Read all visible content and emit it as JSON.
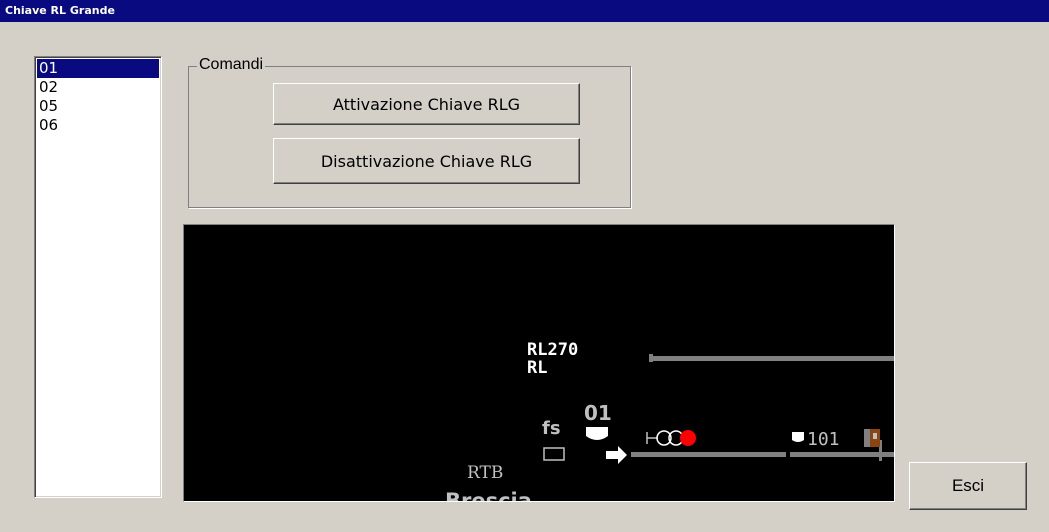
{
  "window": {
    "title": "Chiave RL Grande"
  },
  "list": {
    "items": [
      {
        "label": "01",
        "selected": true
      },
      {
        "label": "02",
        "selected": false
      },
      {
        "label": "05",
        "selected": false
      },
      {
        "label": "06",
        "selected": false
      }
    ]
  },
  "commands": {
    "group_label": "Comandi",
    "activate_label": "Attivazione Chiave RLG",
    "deactivate_label": "Disattivazione Chiave RLG"
  },
  "exit_label": "Esci",
  "schematic": {
    "rl_code": "RL270",
    "rl_type": "RL",
    "fs_label": "fs",
    "signal_number": "01",
    "track_number": "101",
    "rtb_label": "RTB",
    "station_label": "Brescia",
    "colors": {
      "background": "#000000",
      "track": "#808080",
      "signal_red": "#ff0000",
      "text": "#ffffff",
      "dim_text": "#c0c0c0",
      "marker_brown": "#8b4513"
    }
  }
}
